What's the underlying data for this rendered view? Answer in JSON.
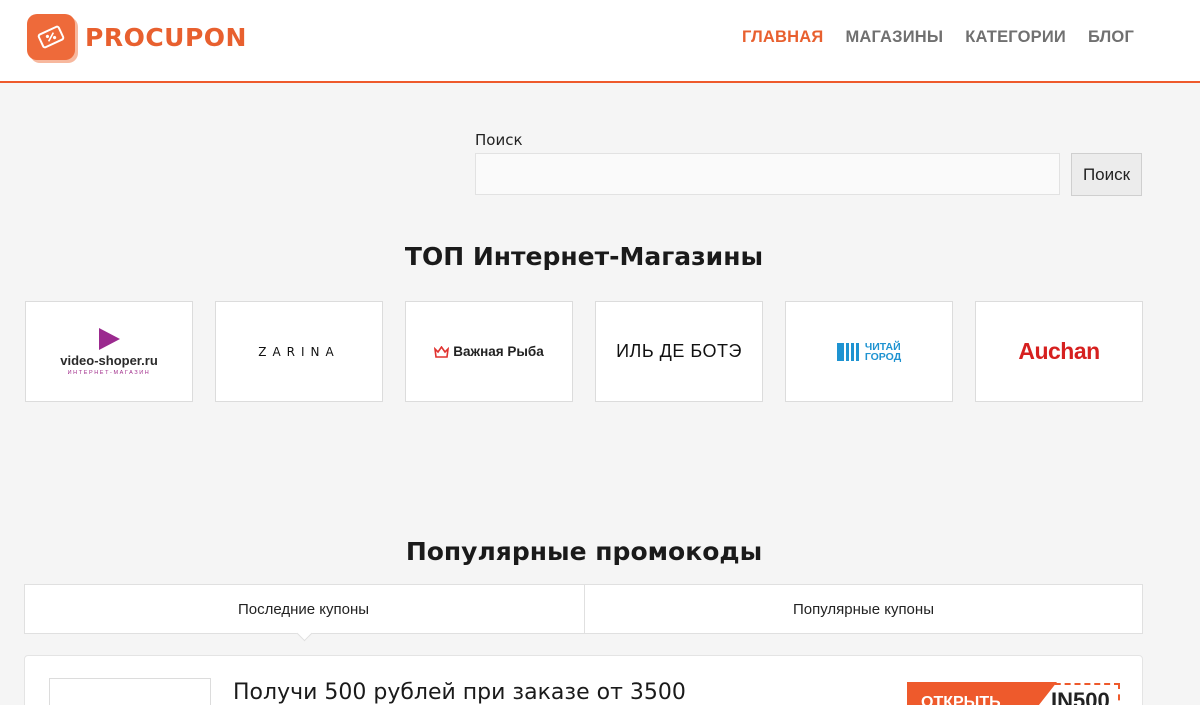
{
  "header": {
    "logo_text": "PROCUPON",
    "nav": [
      {
        "label": "ГЛАВНАЯ",
        "active": true
      },
      {
        "label": "МАГАЗИНЫ",
        "active": false
      },
      {
        "label": "КАТЕГОРИИ",
        "active": false
      },
      {
        "label": "БЛОГ",
        "active": false
      }
    ]
  },
  "search": {
    "label": "Поиск",
    "value": "",
    "placeholder": "",
    "button_label": "Поиск"
  },
  "top_stores": {
    "title": "ТОП Интернет-Магазины",
    "items": [
      {
        "name": "video-shoper.ru",
        "subtitle": "ИНТЕРНЕТ-МАГАЗИН"
      },
      {
        "name": "ZARINA"
      },
      {
        "name": "Важная Рыба"
      },
      {
        "name": "ИЛЬ ДЕ БОТЭ"
      },
      {
        "name_line1": "ЧИТАЙ",
        "name_line2": "ГОРОД"
      },
      {
        "name": "Auchan"
      }
    ]
  },
  "promos": {
    "title": "Популярные промокоды",
    "tabs": [
      {
        "label": "Последние купоны",
        "active": true
      },
      {
        "label": "Популярные купоны",
        "active": false
      }
    ],
    "coupons": [
      {
        "title": "Получи 500 рублей при заказе от 3500",
        "open_label": "ОТКРЫТЬ",
        "code": "IN500"
      }
    ]
  },
  "colors": {
    "accent": "#ee5a2c",
    "nav_inactive": "#707070",
    "background": "#f5f5f5"
  }
}
